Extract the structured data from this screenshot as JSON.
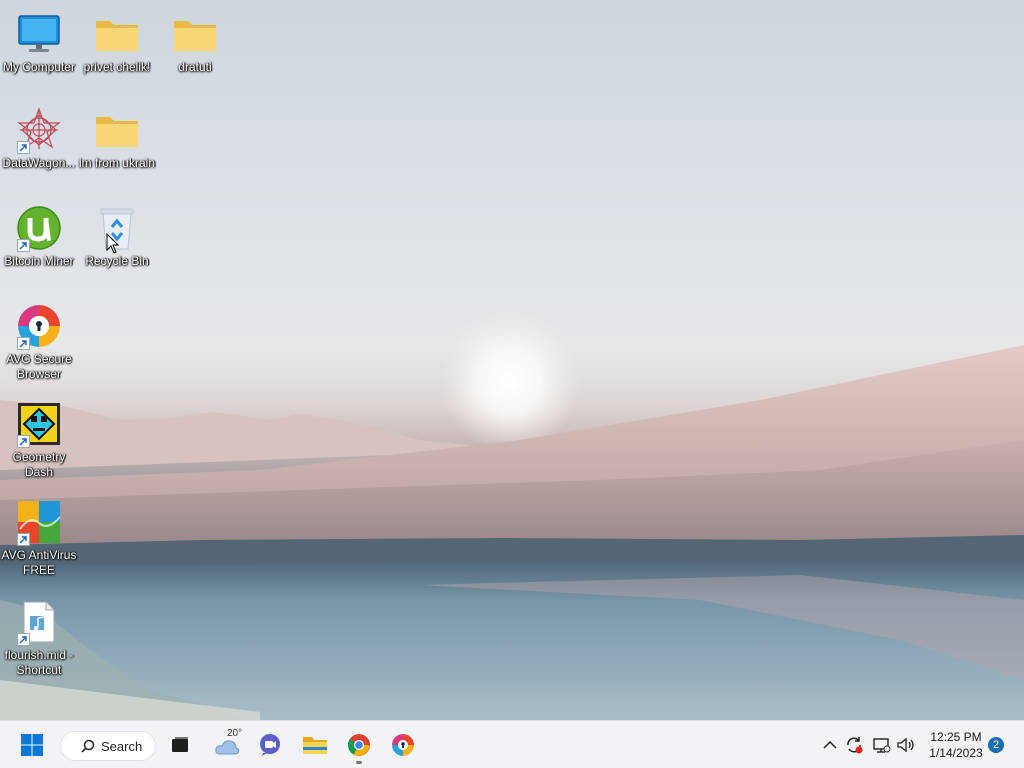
{
  "desktop": {
    "icons": [
      {
        "label": "My Computer",
        "icon": "monitor-icon"
      },
      {
        "label": "privet chelik!",
        "icon": "folder-icon"
      },
      {
        "label": "dratuti",
        "icon": "folder-icon"
      },
      {
        "label": "DataWagon...",
        "icon": "datawagon-icon"
      },
      {
        "label": "im from ukrain",
        "icon": "folder-icon"
      },
      {
        "label": "Bitcoin Miner",
        "icon": "utorrent-icon"
      },
      {
        "label": "Recycle Bin",
        "icon": "recycle-bin-icon"
      },
      {
        "label": "AVG Secure Browser",
        "icon": "avg-secure-browser-icon"
      },
      {
        "label": "Geometry Dash",
        "icon": "geometry-dash-icon"
      },
      {
        "label": "AVG AntiVirus FREE",
        "icon": "avg-antivirus-icon"
      },
      {
        "label": "flourish.mid - Shortcut",
        "icon": "audio-file-icon"
      }
    ]
  },
  "taskbar": {
    "search_label": "Search",
    "weather_temp": "20°",
    "pinned": [
      "start-icon",
      "search-icon",
      "task-view-icon",
      "weather-icon",
      "teams-chat-icon",
      "file-explorer-icon",
      "chrome-icon",
      "avg-secure-browser-icon"
    ],
    "tray": [
      "chevron-up-icon",
      "sync-icon",
      "network-icon",
      "volume-icon"
    ],
    "time": "12:25 PM",
    "date": "1/14/2023",
    "notification_count": "2"
  },
  "colors": {
    "taskbar_bg": "#f1f3f6",
    "accent": "#0078d4",
    "folder": "#f8d775"
  }
}
